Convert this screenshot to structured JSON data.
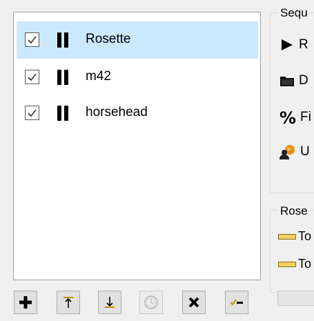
{
  "targets": [
    {
      "name": "Rosette",
      "checked": true,
      "selected": true
    },
    {
      "name": "m42",
      "checked": true,
      "selected": false
    },
    {
      "name": "horsehead",
      "checked": true,
      "selected": false
    }
  ],
  "sequence_group": {
    "title": "Sequ",
    "items": [
      {
        "icon": "play-icon",
        "label": "R"
      },
      {
        "icon": "folder-icon",
        "label": "D"
      },
      {
        "icon": "percent-icon",
        "label": "Fi"
      },
      {
        "icon": "user-globe-icon",
        "label": "U"
      }
    ]
  },
  "target_group": {
    "title": "Rose",
    "items": [
      {
        "icon": "ruler-icon",
        "label": "To"
      },
      {
        "icon": "ruler-icon",
        "label": "To"
      }
    ]
  },
  "toolbar": {
    "buttons": [
      {
        "icon": "plus-icon",
        "enabled": true
      },
      {
        "icon": "move-top-icon",
        "enabled": true
      },
      {
        "icon": "move-bottom-icon",
        "enabled": true
      },
      {
        "icon": "clock-icon",
        "enabled": false
      },
      {
        "icon": "delete-icon",
        "enabled": true
      },
      {
        "icon": "check-list-icon",
        "enabled": true
      }
    ]
  }
}
